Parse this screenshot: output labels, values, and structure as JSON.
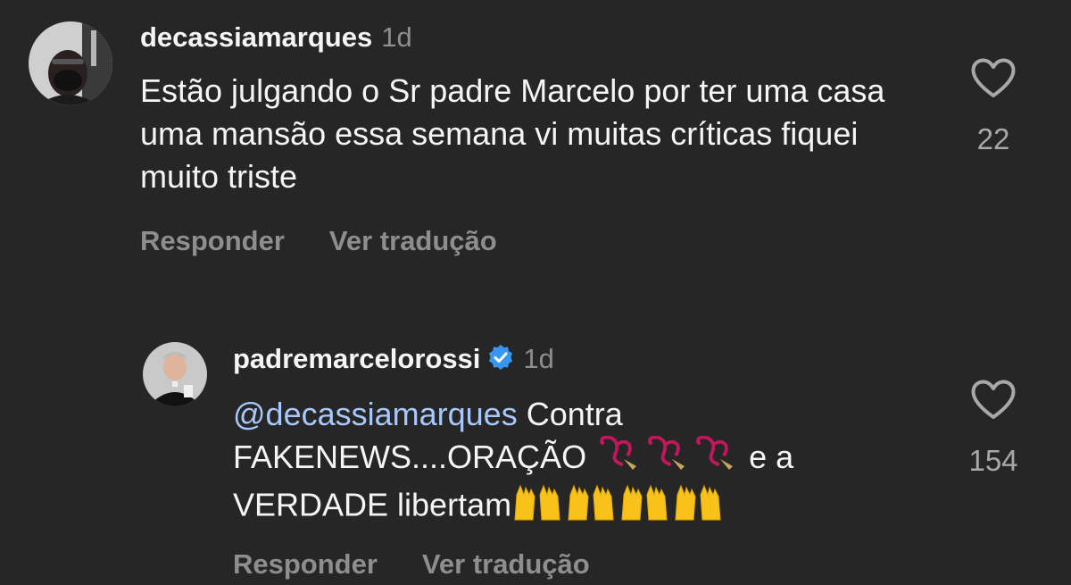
{
  "comments": [
    {
      "username": "decassiamarques",
      "age": "1d",
      "text": "Estão julgando o Sr padre Marcelo por ter uma casa uma mansão essa semana vi muitas críticas fiquei muito triste",
      "likes": "22",
      "reply_label": "Responder",
      "translate_label": "Ver tradução"
    },
    {
      "username": "padremarcelorossi",
      "age": "1d",
      "verified": true,
      "mention": "@decassiamarques",
      "text_line1": " Contra",
      "text_line2": "FAKENEWS....ORAÇÃO",
      "text_line2_end": "e a",
      "text_line3": "VERDADE libertam",
      "likes": "154",
      "reply_label": "Responder",
      "translate_label": "Ver tradução"
    }
  ],
  "icons": {
    "like": "heart-outline-icon",
    "verified": "verified-badge-icon",
    "rosary": "prayer-beads-emoji",
    "hands": "raising-hands-emoji"
  },
  "colors": {
    "background": "#262626",
    "mention": "#a8c7fa",
    "verified": "#3797f0"
  }
}
